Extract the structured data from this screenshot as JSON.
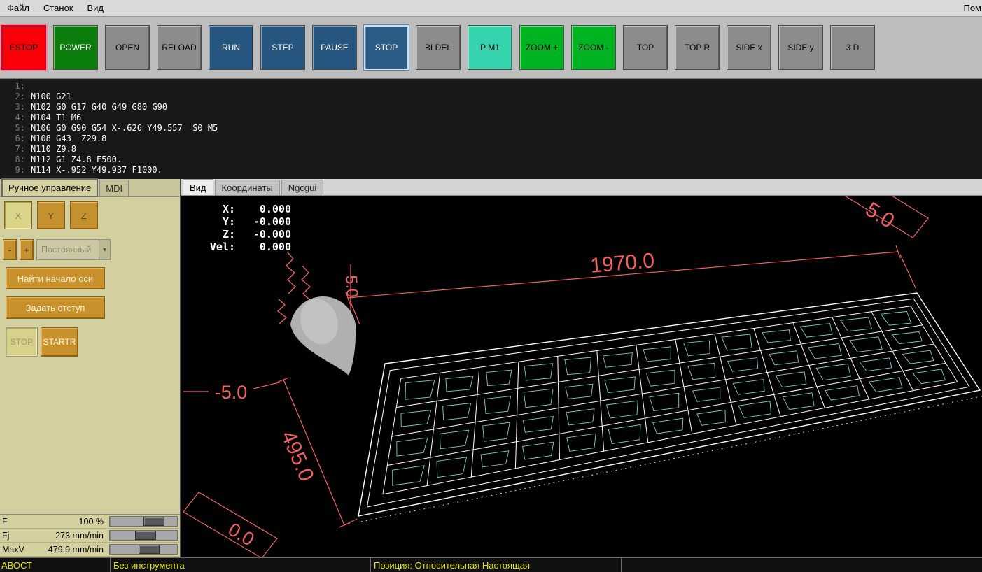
{
  "menubar": {
    "items": [
      "Файл",
      "Станок",
      "Вид"
    ],
    "right": "Пом"
  },
  "toolbar": {
    "buttons": [
      {
        "label": "ESTOP",
        "name": "estop",
        "style": "estop"
      },
      {
        "label": "POWER",
        "name": "power",
        "style": "power"
      },
      {
        "label": "OPEN",
        "name": "open",
        "style": "gray"
      },
      {
        "label": "RELOAD",
        "name": "reload",
        "style": "gray"
      },
      {
        "label": "RUN",
        "name": "run",
        "style": "blue"
      },
      {
        "label": "STEP",
        "name": "step",
        "style": "blue"
      },
      {
        "label": "PAUSE",
        "name": "pause",
        "style": "blue"
      },
      {
        "label": "STOP",
        "name": "stop",
        "style": "blue-active"
      },
      {
        "label": "BLDEL",
        "name": "bldel",
        "style": "gray"
      },
      {
        "label": "P M1",
        "name": "pause-m1",
        "style": "teal"
      },
      {
        "label": "ZOOM +",
        "name": "zoom-in",
        "style": "green"
      },
      {
        "label": "ZOOM -",
        "name": "zoom-out",
        "style": "green"
      },
      {
        "label": "TOP",
        "name": "view-top",
        "style": "gray"
      },
      {
        "label": "TOP R",
        "name": "view-top-r",
        "style": "gray"
      },
      {
        "label": "SIDE x",
        "name": "view-side-x",
        "style": "gray"
      },
      {
        "label": "SIDE y",
        "name": "view-side-y",
        "style": "gray"
      },
      {
        "label": "3 D",
        "name": "view-3d",
        "style": "gray"
      }
    ]
  },
  "gcode": {
    "lines": [
      {
        "n": "1:",
        "text": ""
      },
      {
        "n": "2:",
        "text": "N100 G21"
      },
      {
        "n": "3:",
        "text": "N102 G0 G17 G40 G49 G80 G90"
      },
      {
        "n": "4:",
        "text": "N104 T1 M6"
      },
      {
        "n": "5:",
        "text": "N106 G0 G90 G54 X-.626 Y49.557  S0 M5"
      },
      {
        "n": "6:",
        "text": "N108 G43  Z29.8"
      },
      {
        "n": "7:",
        "text": "N110 Z9.8"
      },
      {
        "n": "8:",
        "text": "N112 G1 Z4.8 F500."
      },
      {
        "n": "9:",
        "text": "N114 X-.952 Y49.937 F1000."
      }
    ]
  },
  "manual": {
    "tabs": [
      "Ручное управление",
      "MDI"
    ],
    "axes": [
      "X",
      "Y",
      "Z"
    ],
    "jog_minus": "-",
    "jog_plus": "+",
    "jog_mode": "Постоянный",
    "home_button": "Найти начало оси",
    "touchoff_button": "Задать отступ",
    "spindle_stop": "STOP",
    "spindle_start": "STARTR",
    "overrides": [
      {
        "label": "F",
        "value": "100 %",
        "pos": 0.72
      },
      {
        "label": "Fj",
        "value": "273 mm/min",
        "pos": 0.55
      },
      {
        "label": "MaxV",
        "value": "479.9 mm/min",
        "pos": 0.62
      }
    ]
  },
  "preview": {
    "tabs": [
      "Вид",
      "Координаты",
      "Ngcgui"
    ],
    "dro": [
      {
        "label": "X:",
        "value": "0.000"
      },
      {
        "label": "Y:",
        "value": "-0.000"
      },
      {
        "label": "Z:",
        "value": "-0.000"
      },
      {
        "label": "Vel:",
        "value": "0.000"
      }
    ],
    "dimensions": {
      "length": "1970.0",
      "width": "495.0",
      "z_min": "-5.0",
      "z_size": "5.0",
      "corner_tr": "5.0",
      "corner_bl": "0.0"
    },
    "colors": {
      "dimension": "#f06060",
      "toolpath": "#7ed0cc",
      "wireframe": "#ffffff",
      "tool_cone": "#b9b9b9"
    }
  },
  "statusbar": {
    "estop": "АВОСТ",
    "tool": "Без инструмента",
    "position": "Позиция: Относительная Настоящая"
  },
  "colors": {
    "panel_khaki": "#d3cf9f",
    "estop_red": "#fb0007",
    "power_green": "#0a7d0a",
    "run_blue": "#26567f",
    "zoom_green": "#00b321",
    "pm1_teal": "#35d3ae",
    "status_yellow": "#e6e600"
  }
}
